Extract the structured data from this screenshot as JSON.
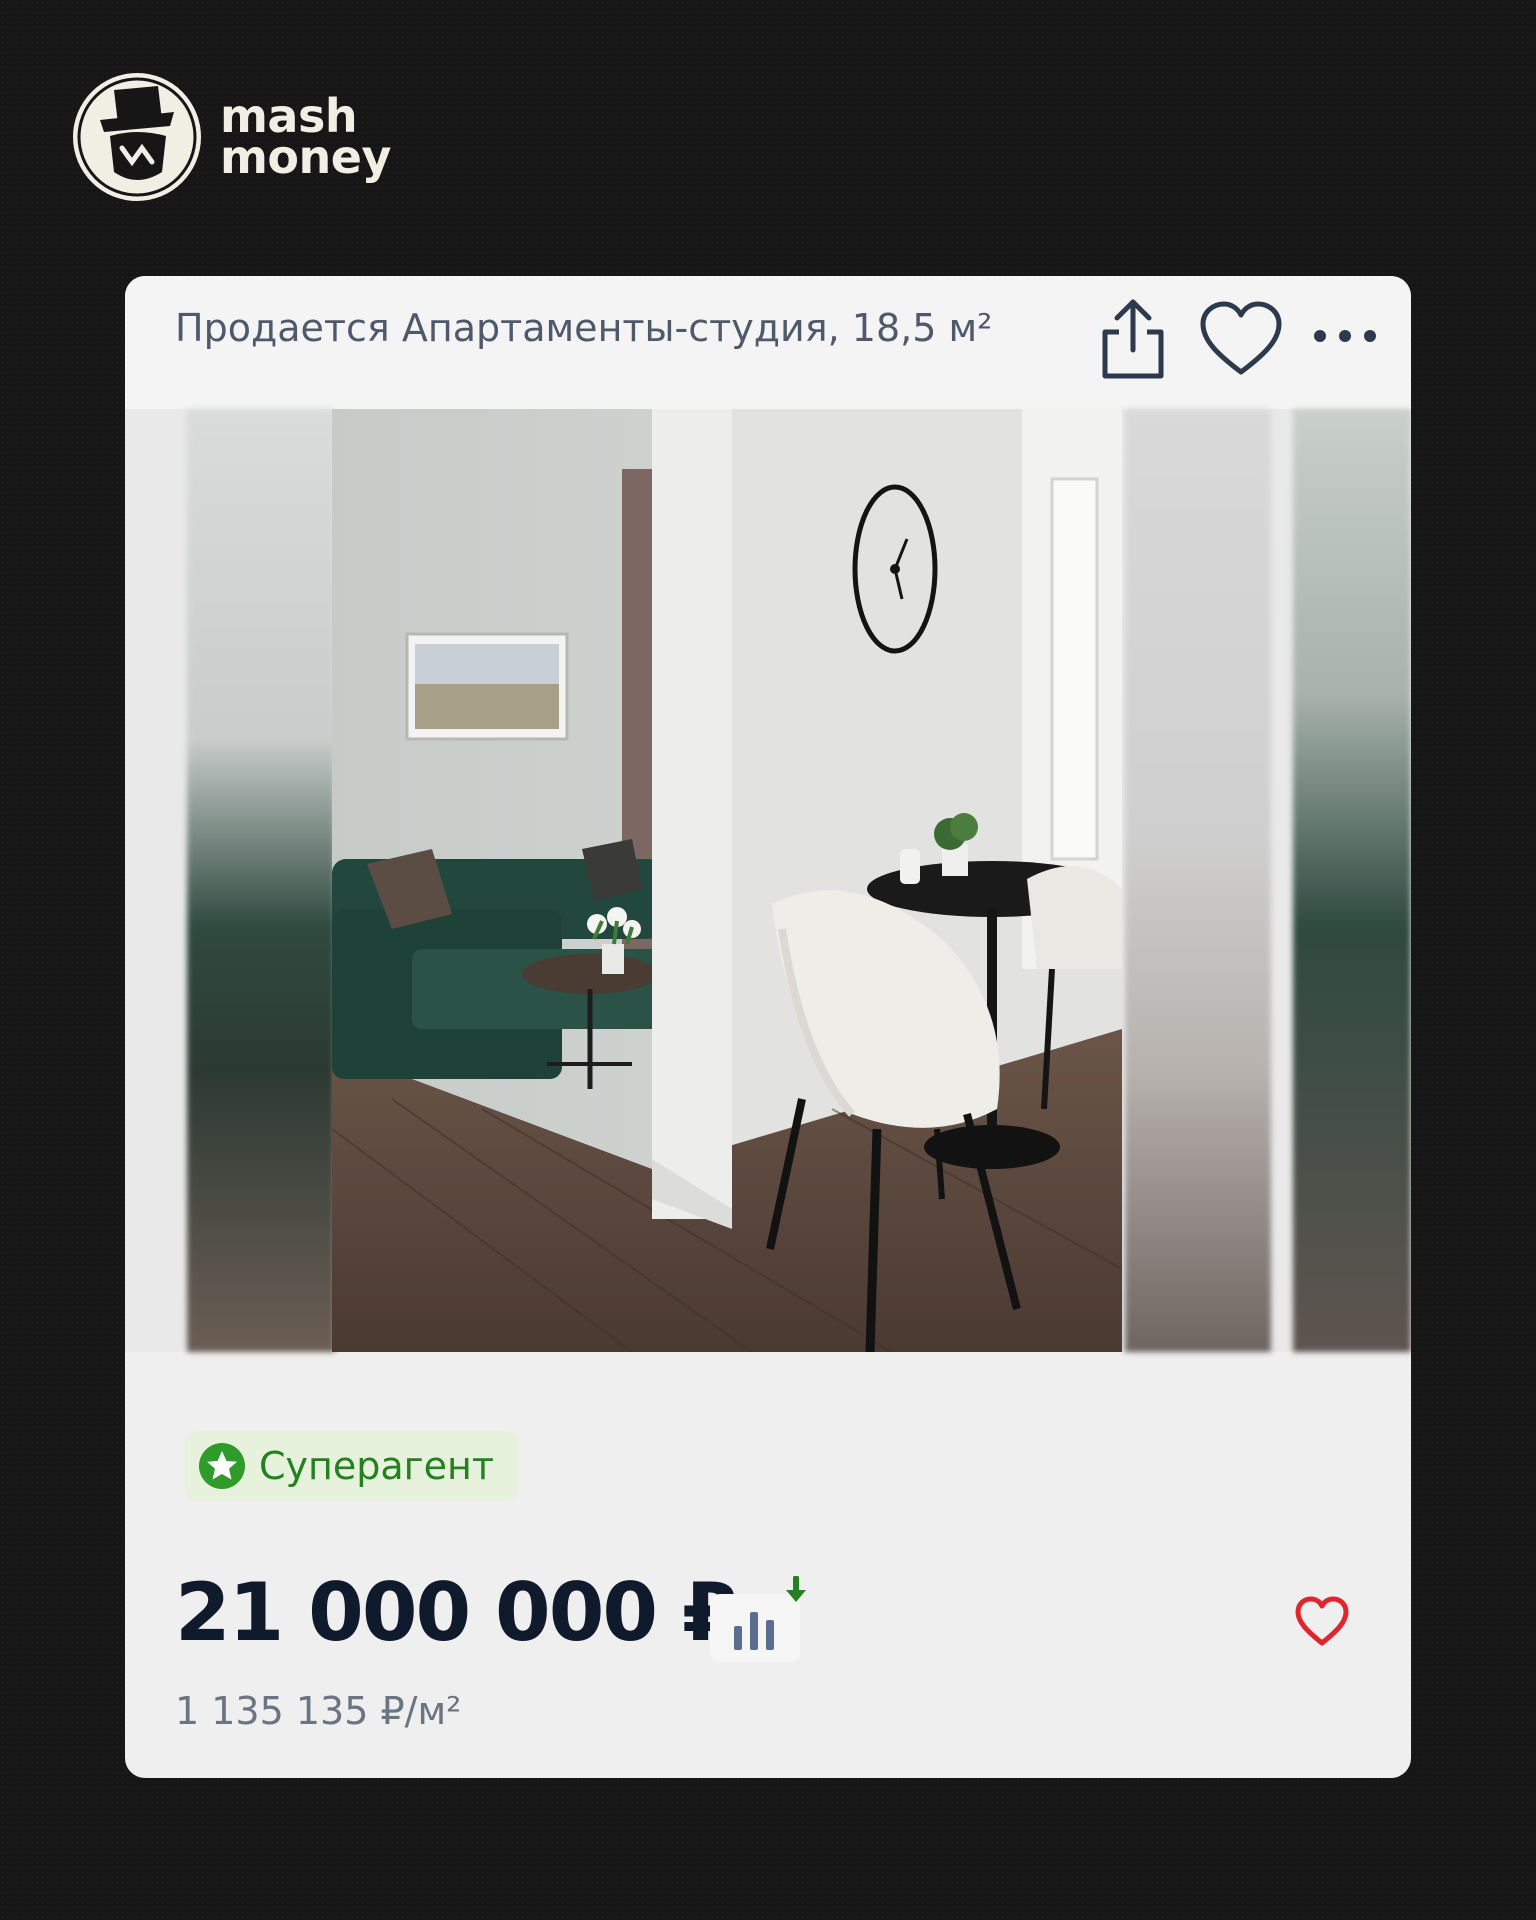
{
  "brand": {
    "line1": "mash",
    "line2": "money",
    "logo_icon": "mascot-hat-logo"
  },
  "listing": {
    "title": "Продается Апартаменты-студия, 18,5 м²",
    "actions": {
      "share_icon": "share-icon",
      "favorite_icon": "heart-icon",
      "more_icon": "more-dots-icon"
    },
    "photo_alt": "Фото квартиры",
    "badge": {
      "label": "Суперагент",
      "icon": "star-badge-icon",
      "color": "#23811f"
    },
    "price": "21 000 000 ₽",
    "price_trend_icon": "price-history-chart-icon",
    "price_per_m": "1 135 135 ₽/м²",
    "favorite_color": "#e0262c"
  }
}
